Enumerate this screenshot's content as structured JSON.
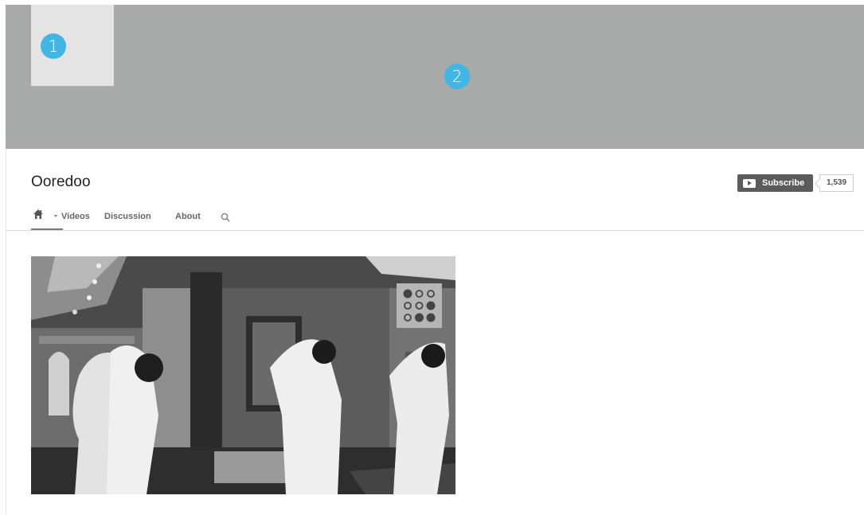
{
  "annotations": {
    "marker_1": "1",
    "marker_2": "2"
  },
  "channel": {
    "title": "Ooredoo"
  },
  "subscribe": {
    "label": "Subscribe",
    "count": "1,539"
  },
  "nav": {
    "tabs": [
      {
        "label": "Videos"
      },
      {
        "label": "Discussion"
      },
      {
        "label": "About"
      }
    ],
    "icons": [
      "home-icon",
      "chevron-down-icon",
      "search-icon"
    ]
  },
  "featured_video": {
    "logo_icon": "ooredoo-logo-icon"
  },
  "colors": {
    "banner": "#a8aaa9",
    "avatar": "#e4e4e4",
    "marker": "#3fb6e4",
    "subscribe": "#5b5b5b"
  }
}
